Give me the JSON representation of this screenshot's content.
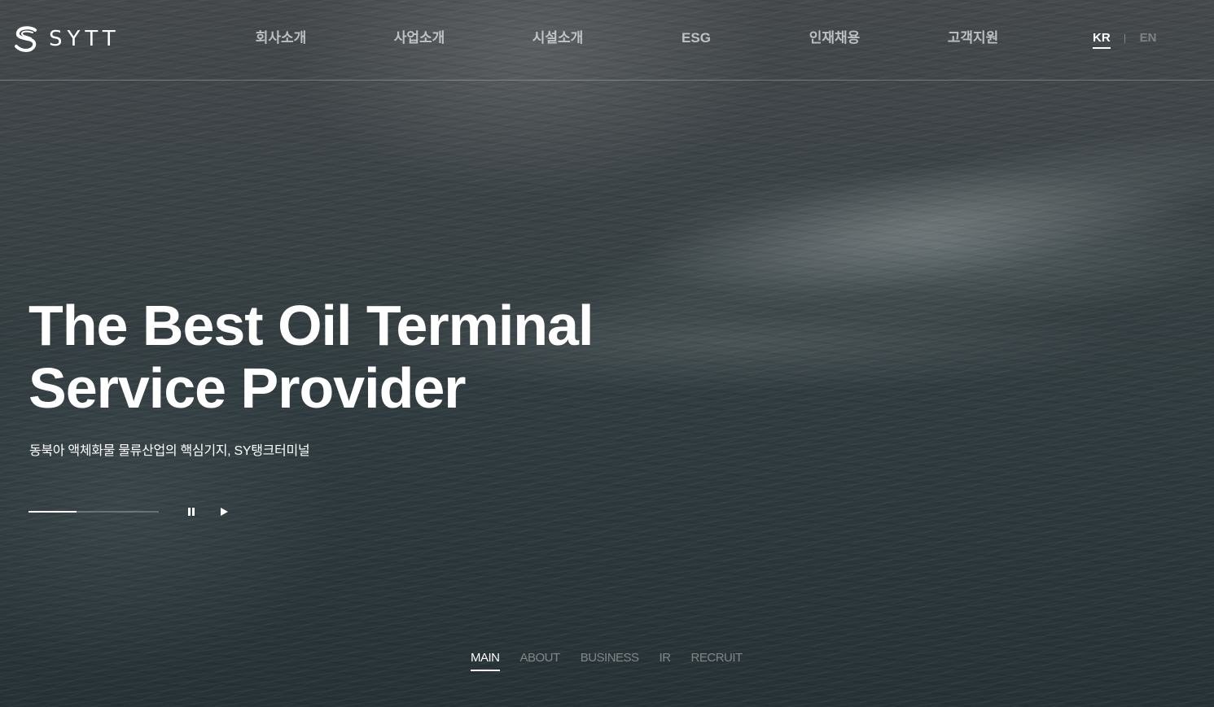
{
  "brand": {
    "logo_text": "SYTT"
  },
  "gnb": {
    "items": [
      {
        "label": "회사소개"
      },
      {
        "label": "사업소개"
      },
      {
        "label": "시설소개"
      },
      {
        "label": "ESG"
      },
      {
        "label": "인재채용"
      },
      {
        "label": "고객지원"
      }
    ]
  },
  "lang": {
    "kr": "KR",
    "en": "EN",
    "selected": "KR"
  },
  "hero": {
    "title_line1": "The Best Oil Terminal",
    "title_line2": "Service Provider",
    "subtitle": "동북아 액체화물 물류산업의 핵심기지, SY탱크터미널",
    "slide_progress": 0.37
  },
  "icons": {
    "logo": "sytt-s-logo-icon",
    "pause": "pause-icon",
    "play": "play-icon"
  },
  "section_nav": {
    "items": [
      {
        "label": "MAIN",
        "active": true
      },
      {
        "label": "ABOUT",
        "active": false
      },
      {
        "label": "BUSINESS",
        "active": false
      },
      {
        "label": "IR",
        "active": false
      },
      {
        "label": "RECRUIT",
        "active": false
      }
    ]
  },
  "colors": {
    "text": "#ffffff",
    "inactive": "#c8c8c8",
    "background": "#2f3b3f"
  }
}
